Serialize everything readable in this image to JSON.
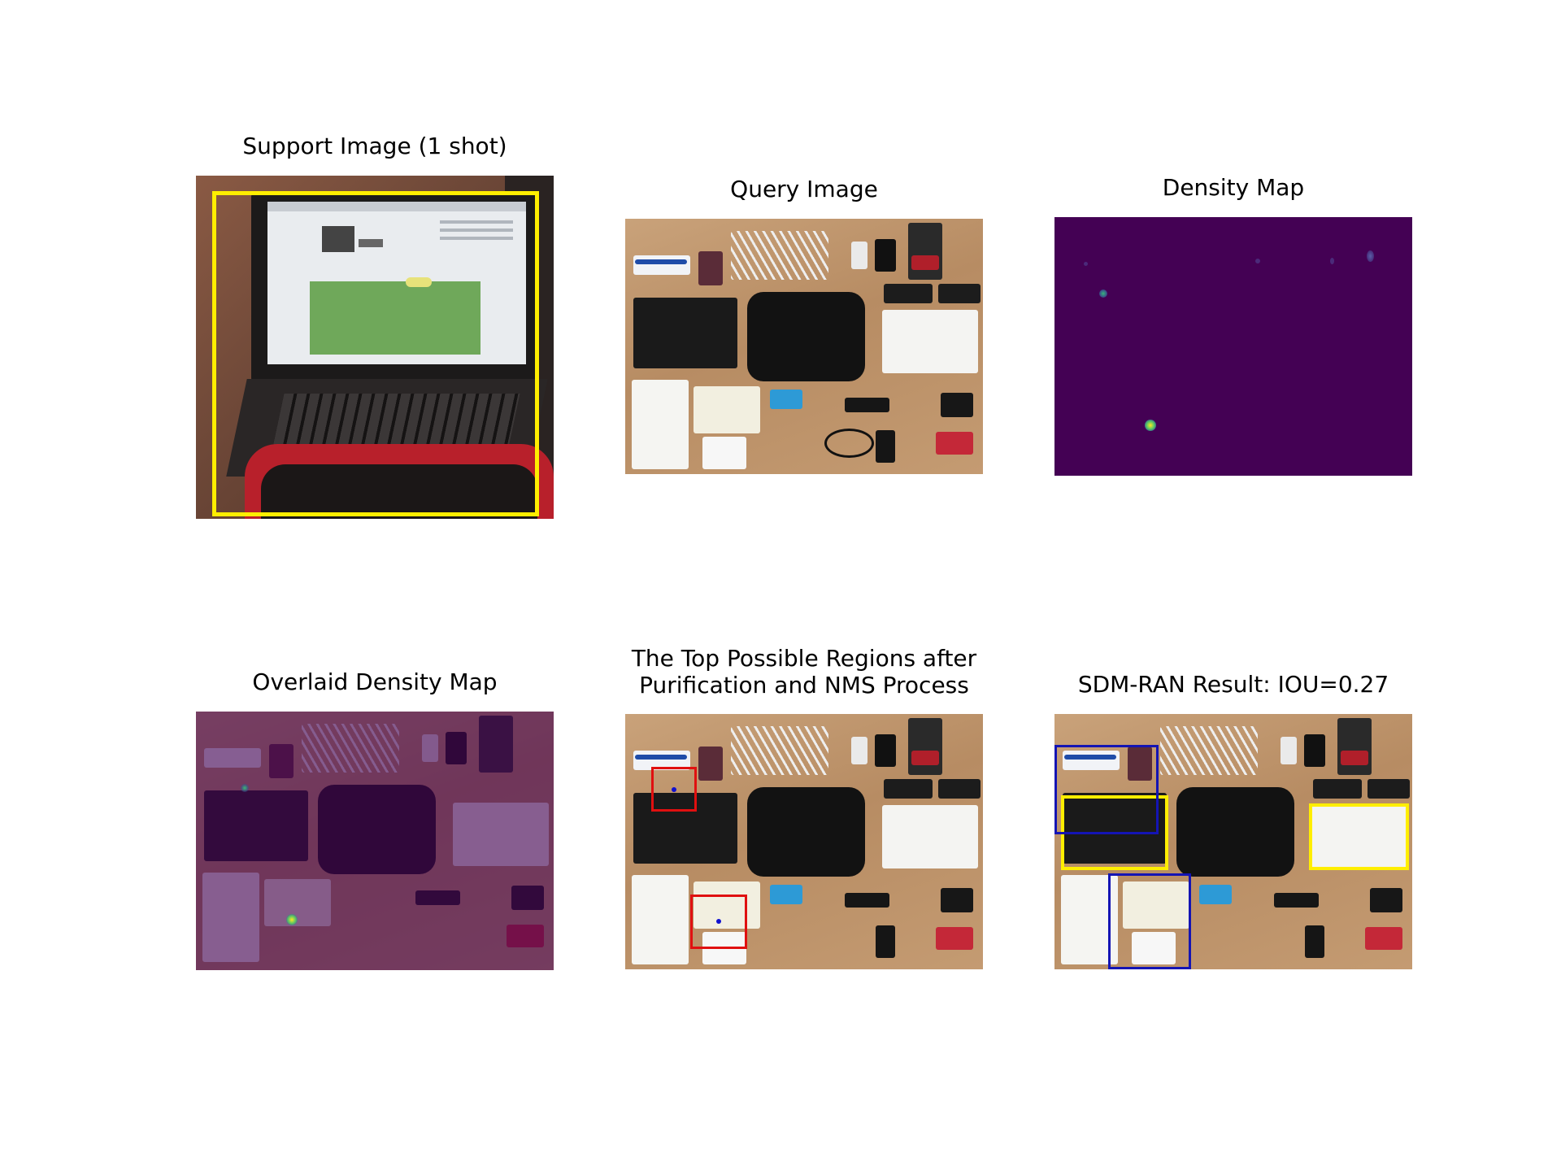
{
  "panels": {
    "support": {
      "title": "Support Image (1 shot)"
    },
    "query": {
      "title": "Query Image"
    },
    "density": {
      "title": "Density Map"
    },
    "overlaid": {
      "title": "Overlaid Density Map"
    },
    "regions": {
      "title_line1": "The Top Possible Regions after",
      "title_line2": "Purification and NMS Process"
    },
    "result": {
      "title": "SDM-RAN Result: IOU=0.27"
    }
  },
  "colors": {
    "support_box": "#ffee00",
    "candidate_box": "#e01010",
    "candidate_center": "#1010d0",
    "predicted_box": "#1414b4",
    "ground_truth_box": "#ffee00",
    "density_background": "#440154",
    "density_peak": "#a6db3a"
  },
  "icons": [
    "laptop-photo",
    "flatlay-photo",
    "density-heatmap"
  ]
}
